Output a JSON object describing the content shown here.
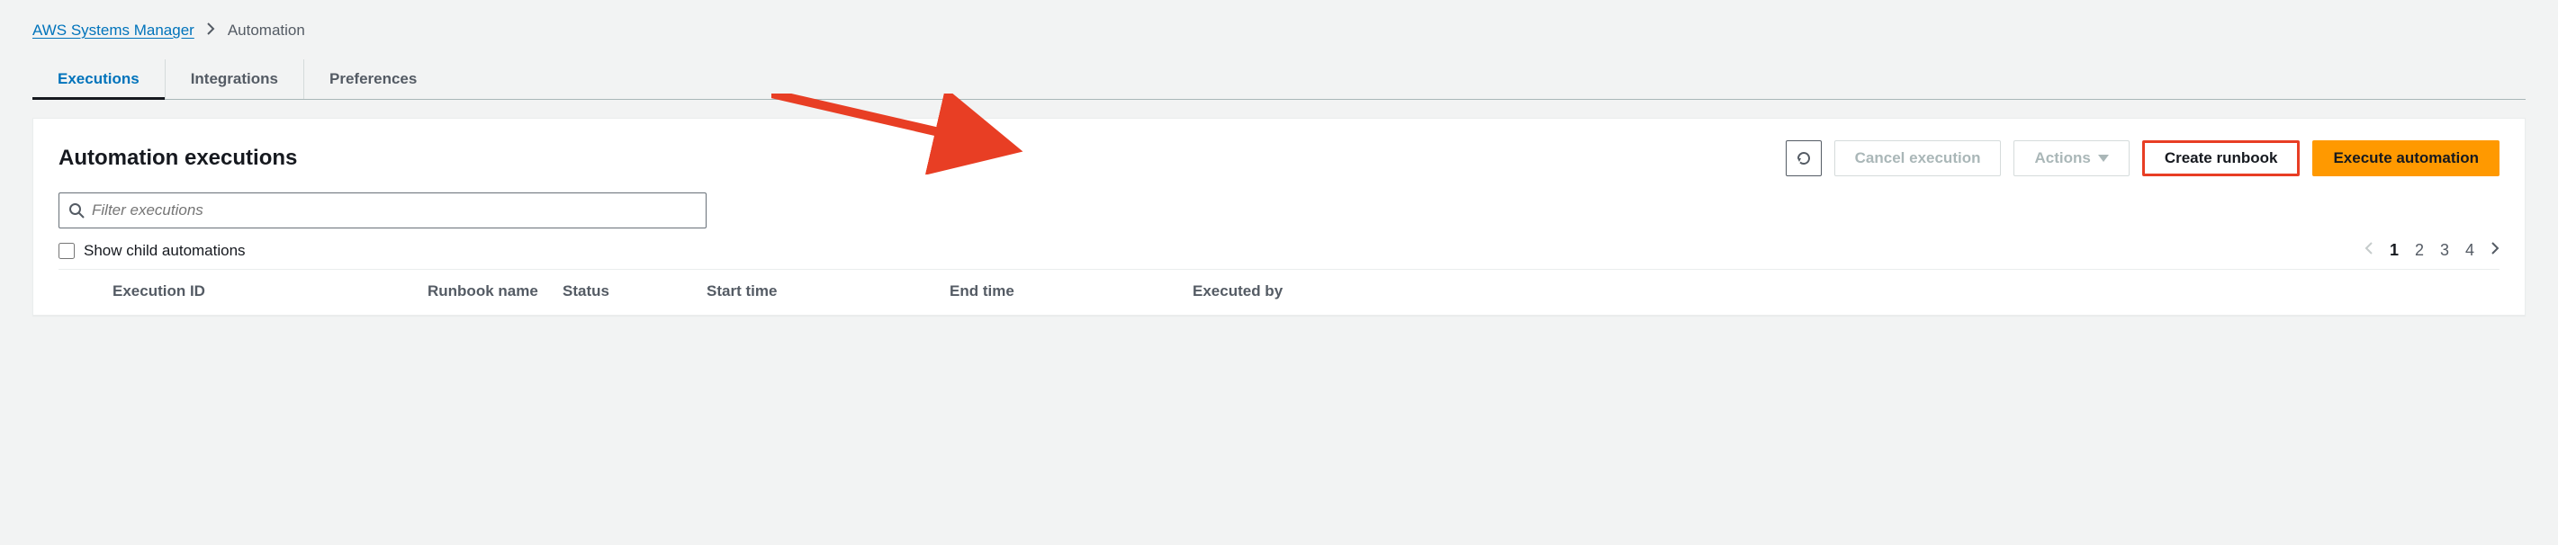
{
  "breadcrumb": {
    "root": "AWS Systems Manager",
    "current": "Automation"
  },
  "tabs": [
    {
      "id": "executions",
      "label": "Executions",
      "active": true
    },
    {
      "id": "integrations",
      "label": "Integrations",
      "active": false
    },
    {
      "id": "preferences",
      "label": "Preferences",
      "active": false
    }
  ],
  "panel": {
    "title": "Automation executions",
    "buttons": {
      "refresh_icon": "refresh",
      "cancel_label": "Cancel execution",
      "actions_label": "Actions",
      "create_label": "Create runbook",
      "execute_label": "Execute automation"
    },
    "filter": {
      "placeholder": "Filter executions",
      "icon": "search"
    },
    "show_child_label": "Show child automations",
    "show_child_checked": false,
    "pagination": {
      "pages": [
        "1",
        "2",
        "3",
        "4"
      ],
      "current": "1"
    },
    "columns": {
      "exec_id": "Execution ID",
      "runbook": "Runbook name",
      "status": "Status",
      "start": "Start time",
      "end": "End time",
      "by": "Executed by"
    }
  },
  "annotation": {
    "color": "#e83e24",
    "target": "create_runbook_button"
  }
}
